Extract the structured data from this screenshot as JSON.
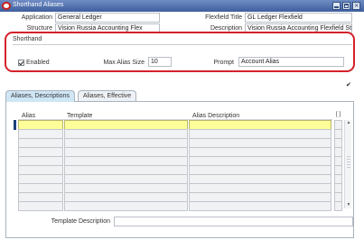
{
  "window": {
    "title": "Shorthand Aliases",
    "controls": [
      "minimize",
      "maximize",
      "close"
    ]
  },
  "header_fields": {
    "application_label": "Application",
    "application_value": "General Ledger",
    "flexfield_title_label": "Flexfield Title",
    "flexfield_title_value": "GL Ledger Flexfield",
    "structure_label": "Structure",
    "structure_value": "Vision Russia Accounting Flex",
    "description_label": "Description",
    "description_value": "Vision Russia Accounting Flexfield Stru"
  },
  "shorthand": {
    "section_title": "Shorthand",
    "enabled_label": "Enabled",
    "enabled_checked": true,
    "max_alias_size_label": "Max Alias Size",
    "max_alias_size_value": "10",
    "prompt_label": "Prompt",
    "prompt_value": "Account Alias"
  },
  "tabs": [
    {
      "label": "Aliases, Descriptions",
      "active": true
    },
    {
      "label": "Aliases, Effective",
      "active": false
    }
  ],
  "table": {
    "columns": [
      "Alias",
      "Template",
      "Alias Description"
    ],
    "row_count": 10,
    "selected_row": 0
  },
  "footer": {
    "template_description_label": "Template Description",
    "template_description_value": ""
  },
  "colors": {
    "titlebar": "#4f6fae",
    "highlight_box": "#d4212b",
    "selected_row": "#ffff99",
    "active_tab": "#cfe6f5"
  }
}
